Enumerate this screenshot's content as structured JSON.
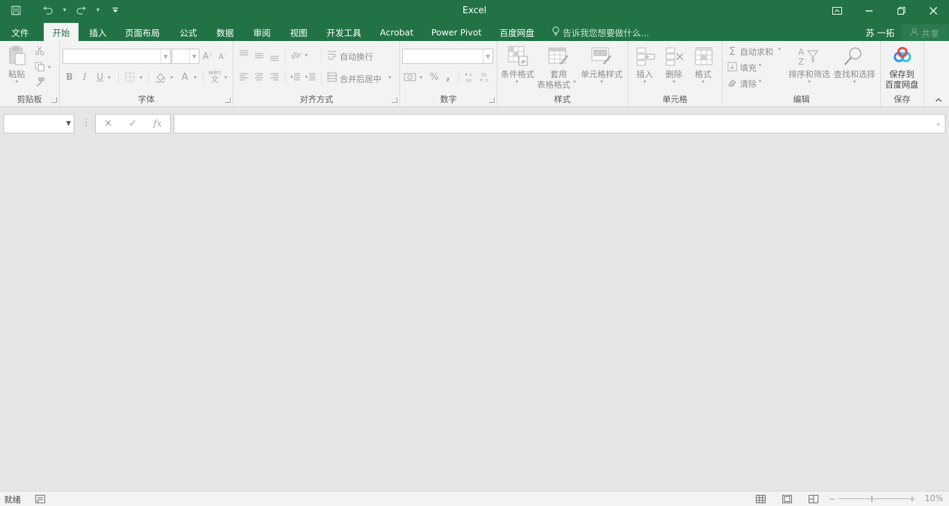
{
  "app": {
    "title": "Excel",
    "accent_color": "#217346"
  },
  "qat": {
    "save_icon": "save-icon",
    "undo_icon": "undo-icon",
    "redo_icon": "redo-icon",
    "customize_icon": "customize-qat-icon"
  },
  "tabs": [
    {
      "label": "文件"
    },
    {
      "label": "开始"
    },
    {
      "label": "插入"
    },
    {
      "label": "页面布局"
    },
    {
      "label": "公式"
    },
    {
      "label": "数据"
    },
    {
      "label": "审阅"
    },
    {
      "label": "视图"
    },
    {
      "label": "开发工具"
    },
    {
      "label": "Acrobat"
    },
    {
      "label": "Power Pivot"
    },
    {
      "label": "百度网盘"
    }
  ],
  "active_tab": "开始",
  "tellme": {
    "placeholder": "告诉我您想要做什么..."
  },
  "user": {
    "name": "苏 一拓"
  },
  "share": {
    "label": "共享"
  },
  "ribbon": {
    "clipboard": {
      "group_label": "剪贴板",
      "paste_label": "粘贴"
    },
    "font": {
      "group_label": "字体",
      "bold": "B",
      "italic": "I",
      "underline": "U",
      "font_color": "A",
      "phonetic": "wén"
    },
    "alignment": {
      "group_label": "对齐方式",
      "wrap_text": "自动换行",
      "merge_center": "合并后居中"
    },
    "number": {
      "group_label": "数字",
      "percent": "%",
      "comma": ","
    },
    "styles": {
      "group_label": "样式",
      "conditional": "条件格式",
      "format_table_1": "套用",
      "format_table_2": "表格格式",
      "cell_styles": "单元格样式"
    },
    "cells": {
      "group_label": "单元格",
      "insert": "插入",
      "delete": "删除",
      "format": "格式"
    },
    "editing": {
      "group_label": "编辑",
      "autosum": "自动求和",
      "fill": "填充",
      "clear": "清除",
      "sort_filter": "排序和筛选",
      "find_select": "查找和选择"
    },
    "save": {
      "group_label": "保存",
      "save_to_1": "保存到",
      "save_to_2": "百度网盘"
    }
  },
  "formula_bar": {
    "fx_label": "fx"
  },
  "status": {
    "ready": "就绪",
    "zoom": "10%"
  }
}
